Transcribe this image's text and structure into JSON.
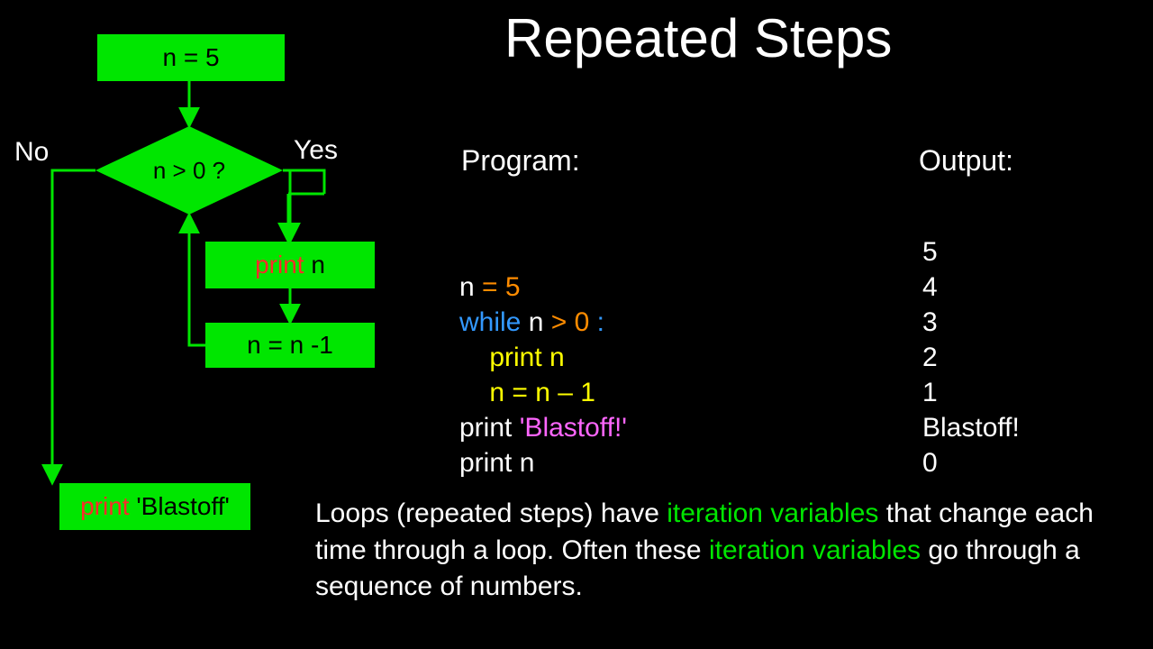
{
  "title": "Repeated Steps",
  "flowchart": {
    "init": "n = 5",
    "condition": "n > 0 ?",
    "print_n_pre": "print ",
    "print_n_var": "n",
    "decrement": "n = n -1",
    "blastoff": "print 'Blastoff'",
    "no_label": "No",
    "yes_label": "Yes"
  },
  "labels": {
    "program": "Program:",
    "output": "Output:"
  },
  "program": {
    "l1_a": "n ",
    "l1_b": "= 5",
    "l2_a": "while",
    "l2_b": " n ",
    "l2_c": "> 0 ",
    "l2_d": ":",
    "l3": "    print n",
    "l4": "    n = n – 1",
    "l5_a": "print ",
    "l5_b": "'Blastoff!'",
    "l6": "print n"
  },
  "output": {
    "l1": "5",
    "l2": "4",
    "l3": "3",
    "l4": "2",
    "l5": "1",
    "l6": "Blastoff!",
    "l7": "0"
  },
  "description": {
    "t1": "Loops (repeated steps) have ",
    "iv1": "iteration variables",
    "t2": " that change each time through a loop.  Often these ",
    "iv2": "iteration variables",
    "t3": " go through a sequence of numbers."
  },
  "colors": {
    "green": "#00e600",
    "orange": "#ff8c00",
    "blue": "#3399ff",
    "yellow": "#ffff00",
    "magenta": "#ff66ff",
    "red": "#ff2a2a"
  }
}
